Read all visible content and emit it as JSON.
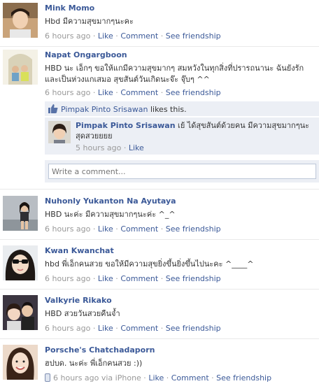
{
  "posts": [
    {
      "name": "Mink Momo",
      "message": "Hbd มีความสุขมากๆนะคะ",
      "time": "6 hours ago",
      "sep": " · ",
      "like": "Like",
      "comment": "Comment",
      "friendship": "See friendship"
    },
    {
      "name": "Napat Ongargboon",
      "message": "HBD นะ เอ็กๆ ขอให้แกมีความสุขมากๆ สมหวังในทุกสิ่งที่ปรารถนานะ ฉันยังรักและเป็นห่วงแกเสมอ สุขสันต์วันเกิดนะจ๊ะ จุ๊บๆ ^^",
      "time": "6 hours ago",
      "sep": " · ",
      "like": "Like",
      "comment": "Comment",
      "friendship": "See friendship",
      "likes": {
        "liker": "Pimpak Pinto Srisawan",
        "text": " likes this."
      },
      "reply": {
        "name": "Pimpak Pinto Srisawan",
        "message": " เย้ ได้สุขสันต์ด้วยคน มีความสุขมากๆนะสุดสวยยยย",
        "time": "5 hours ago",
        "sep": " · ",
        "like": "Like"
      },
      "write_placeholder": "Write a comment..."
    },
    {
      "name": "Nuhonly Yukanton Na Ayutaya",
      "message": "HBD นะค่ะ มีความสุขมากๆนะค่ะ ^_^",
      "time": "6 hours ago",
      "sep": " · ",
      "like": "Like",
      "comment": "Comment",
      "friendship": "See friendship"
    },
    {
      "name": "Kwan Kwanchat",
      "message": "hbd พี่เอ็กคนสวย ขอให้มีความสุขยิ่งขึ้นยิ่งขึ้นไปนะคะ ^____^",
      "time": "6 hours ago",
      "sep": " · ",
      "like": "Like",
      "comment": "Comment",
      "friendship": "See friendship"
    },
    {
      "name": "Valkyrie Rikako",
      "message": "HBD สวยวันสวยคืนจ้ำ",
      "time": "6 hours ago",
      "sep": " · ",
      "like": "Like",
      "comment": "Comment",
      "friendship": "See friendship"
    },
    {
      "name": "Porsche's Chatchadaporn",
      "message": "ฮปบด. นะค่ะ พี่เอ็กคนสวย :))",
      "time": "6 hours ago via iPhone",
      "sep": " · ",
      "like": "Like",
      "comment": "Comment",
      "friendship": "See friendship"
    }
  ],
  "colors": {
    "link": "#3b5998",
    "meta": "#999999",
    "comment_bg": "#eceff5"
  },
  "icons": {
    "like_thumb": "thumbs-up-icon",
    "mobile": "mobile-phone-icon"
  }
}
